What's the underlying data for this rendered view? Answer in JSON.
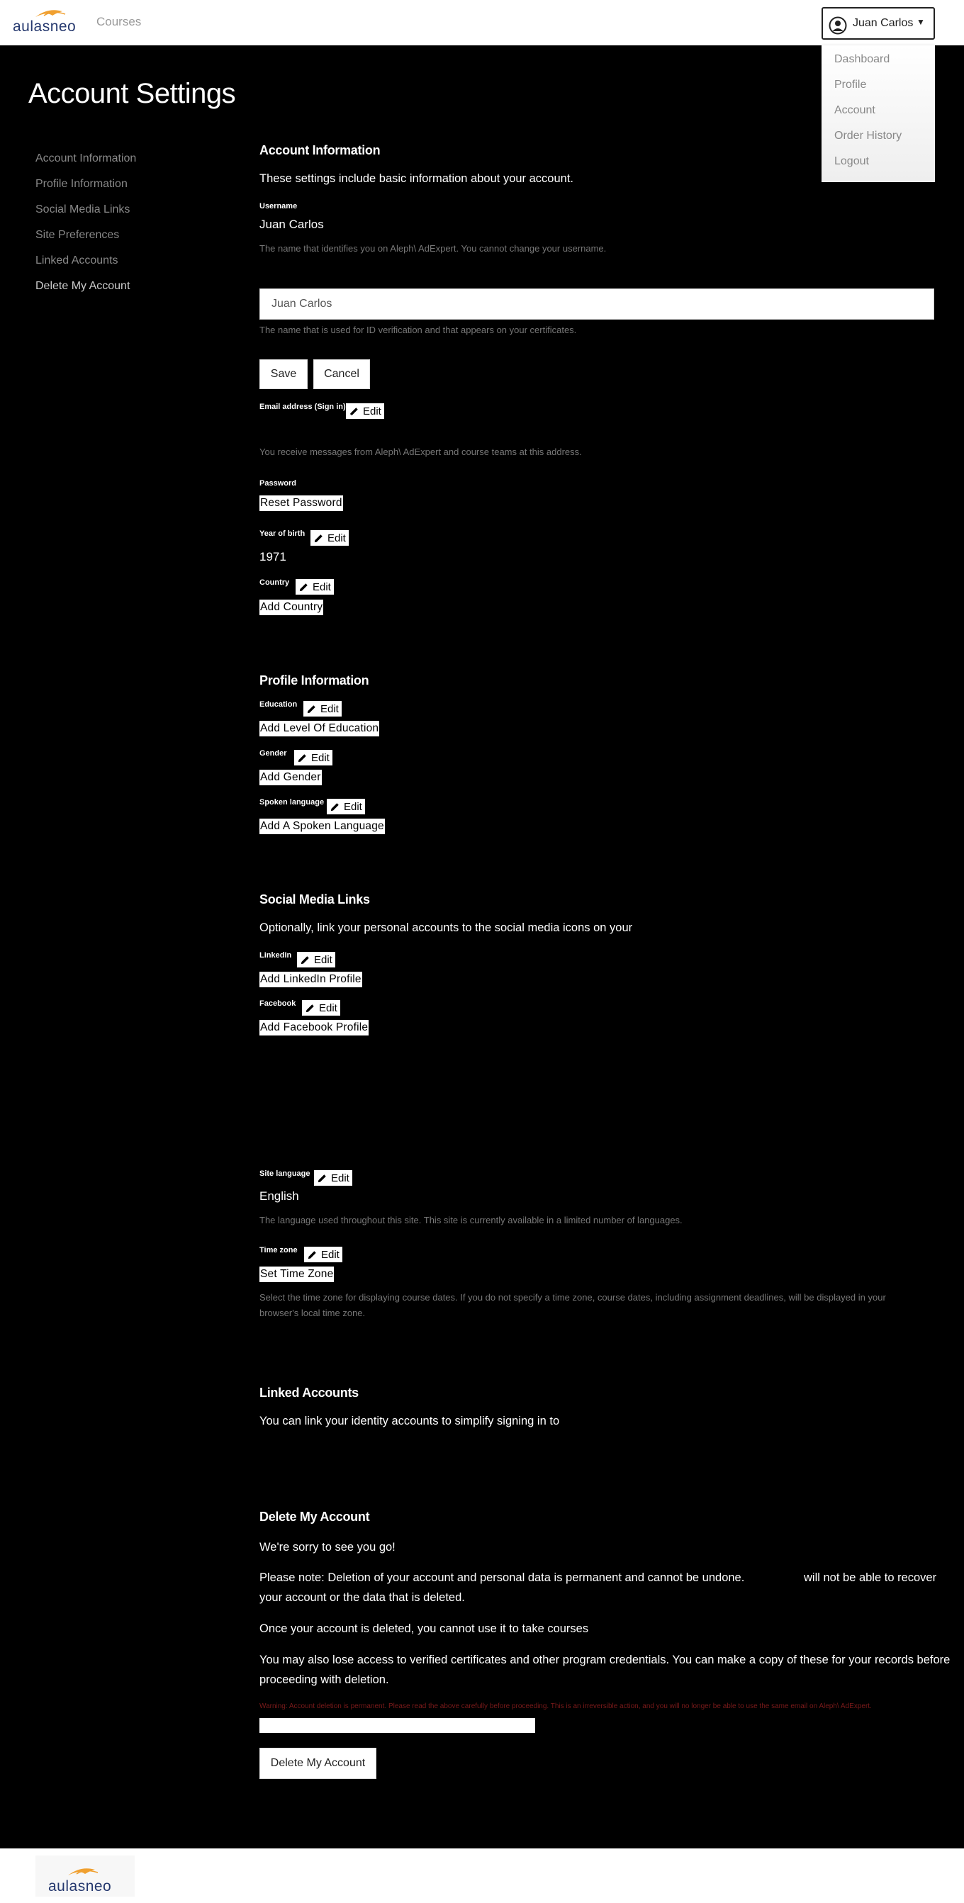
{
  "header": {
    "brand": "aulasneo",
    "courses_link": "Courses",
    "user_name": "Juan Carlos"
  },
  "user_menu": {
    "items": [
      "Dashboard",
      "Profile",
      "Account",
      "Order History",
      "Logout"
    ]
  },
  "page_title": "Account Settings",
  "sidebar": {
    "items": [
      "Account Information",
      "Profile Information",
      "Social Media Links",
      "Site Preferences",
      "Linked Accounts",
      "Delete My Account"
    ]
  },
  "account_info": {
    "heading": "Account Information",
    "intro": "These settings include basic information about your account.",
    "username_label": "Username",
    "username_value": "Juan Carlos",
    "username_help": "The name that identifies you on Aleph\\ AdExpert. You cannot change your username.",
    "fullname_value": "Juan Carlos",
    "fullname_help": "The name that is used for ID verification and that appears on your certificates.",
    "save_label": "Save",
    "cancel_label": "Cancel",
    "email_label": "Email address (Sign in)",
    "email_help": "You receive messages from Aleph\\ AdExpert and course teams at this address.",
    "password_label": "Password",
    "reset_password": "Reset Password",
    "yob_label": "Year of birth",
    "yob_value": "1971",
    "country_label": "Country",
    "add_country": "Add Country",
    "edit_label": "Edit"
  },
  "profile_info": {
    "heading": "Profile Information",
    "education_label": "Education",
    "add_education": "Add Level Of Education",
    "gender_label": "Gender",
    "add_gender": "Add Gender",
    "language_label": "Spoken language",
    "add_language": "Add A Spoken Language"
  },
  "social": {
    "heading": "Social Media Links",
    "intro": "Optionally, link your personal accounts to the social media icons on your",
    "linkedin_label": "LinkedIn",
    "add_linkedin": "Add LinkedIn Profile",
    "facebook_label": "Facebook",
    "add_facebook": "Add Facebook Profile"
  },
  "site_prefs": {
    "site_language_label": "Site language",
    "site_language_value": "English",
    "site_language_help": "The language used throughout this site. This site is currently available in a limited number of languages.",
    "timezone_label": "Time zone",
    "set_timezone": "Set Time Zone",
    "timezone_help_1": "Select the time zone for displaying course dates. If you do not specify a time zone, course dates, including assignment deadlines, will be displayed in your",
    "timezone_help_2": "browser's local time zone."
  },
  "linked": {
    "heading": "Linked Accounts",
    "intro": "You can link your identity accounts to simplify signing in to"
  },
  "delete": {
    "heading": "Delete My Account",
    "sorry": "We're sorry to see you go!",
    "note_1": "Please note: Deletion of your account and personal data is permanent and cannot be undone.",
    "note_1b": "will not be able to recover",
    "note_2": "your account or the data that is deleted.",
    "once": "Once your account is deleted, you cannot use it to take courses",
    "also_1": "You may also lose access to verified certificates and other program credentials. You can make a copy of these for your records before",
    "also_2": "proceeding with deletion.",
    "warning": "Warning: Account deletion is permanent. Please read the above carefully before proceeding. This is an irreversible action, and you will no longer be able to use the same email on Aleph\\ AdExpert.",
    "button": "Delete My Account"
  },
  "footer": {
    "brand": "aulasneo"
  },
  "colors": {
    "brand_navy": "#25386e",
    "brand_orange": "#f0a030",
    "warning": "#7a1a1a"
  }
}
